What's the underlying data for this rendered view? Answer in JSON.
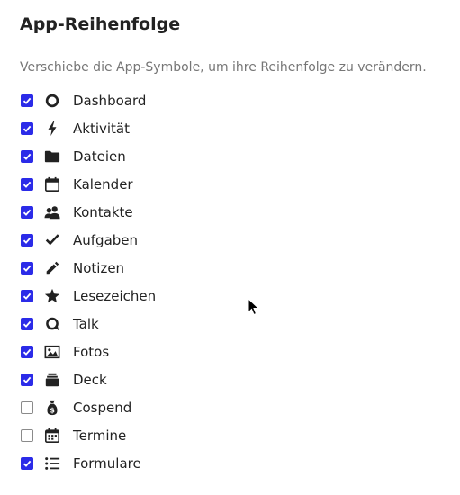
{
  "header": {
    "title": "App-Reihenfolge",
    "hint": "Verschiebe die App-Symbole, um ihre Reihenfolge zu verändern."
  },
  "accent_color": "#2b2be8",
  "apps": [
    {
      "label": "Dashboard",
      "icon": "dashboard-icon",
      "checked": true
    },
    {
      "label": "Aktivität",
      "icon": "activity-icon",
      "checked": true
    },
    {
      "label": "Dateien",
      "icon": "folder-icon",
      "checked": true
    },
    {
      "label": "Kalender",
      "icon": "calendar-icon",
      "checked": true
    },
    {
      "label": "Kontakte",
      "icon": "contacts-icon",
      "checked": true
    },
    {
      "label": "Aufgaben",
      "icon": "checkmark-icon",
      "checked": true
    },
    {
      "label": "Notizen",
      "icon": "pencil-icon",
      "checked": true
    },
    {
      "label": "Lesezeichen",
      "icon": "star-icon",
      "checked": true
    },
    {
      "label": "Talk",
      "icon": "talk-icon",
      "checked": true
    },
    {
      "label": "Fotos",
      "icon": "image-icon",
      "checked": true
    },
    {
      "label": "Deck",
      "icon": "deck-icon",
      "checked": true
    },
    {
      "label": "Cospend",
      "icon": "money-bag-icon",
      "checked": false
    },
    {
      "label": "Termine",
      "icon": "appointments-icon",
      "checked": false
    },
    {
      "label": "Formulare",
      "icon": "list-icon",
      "checked": true
    }
  ]
}
